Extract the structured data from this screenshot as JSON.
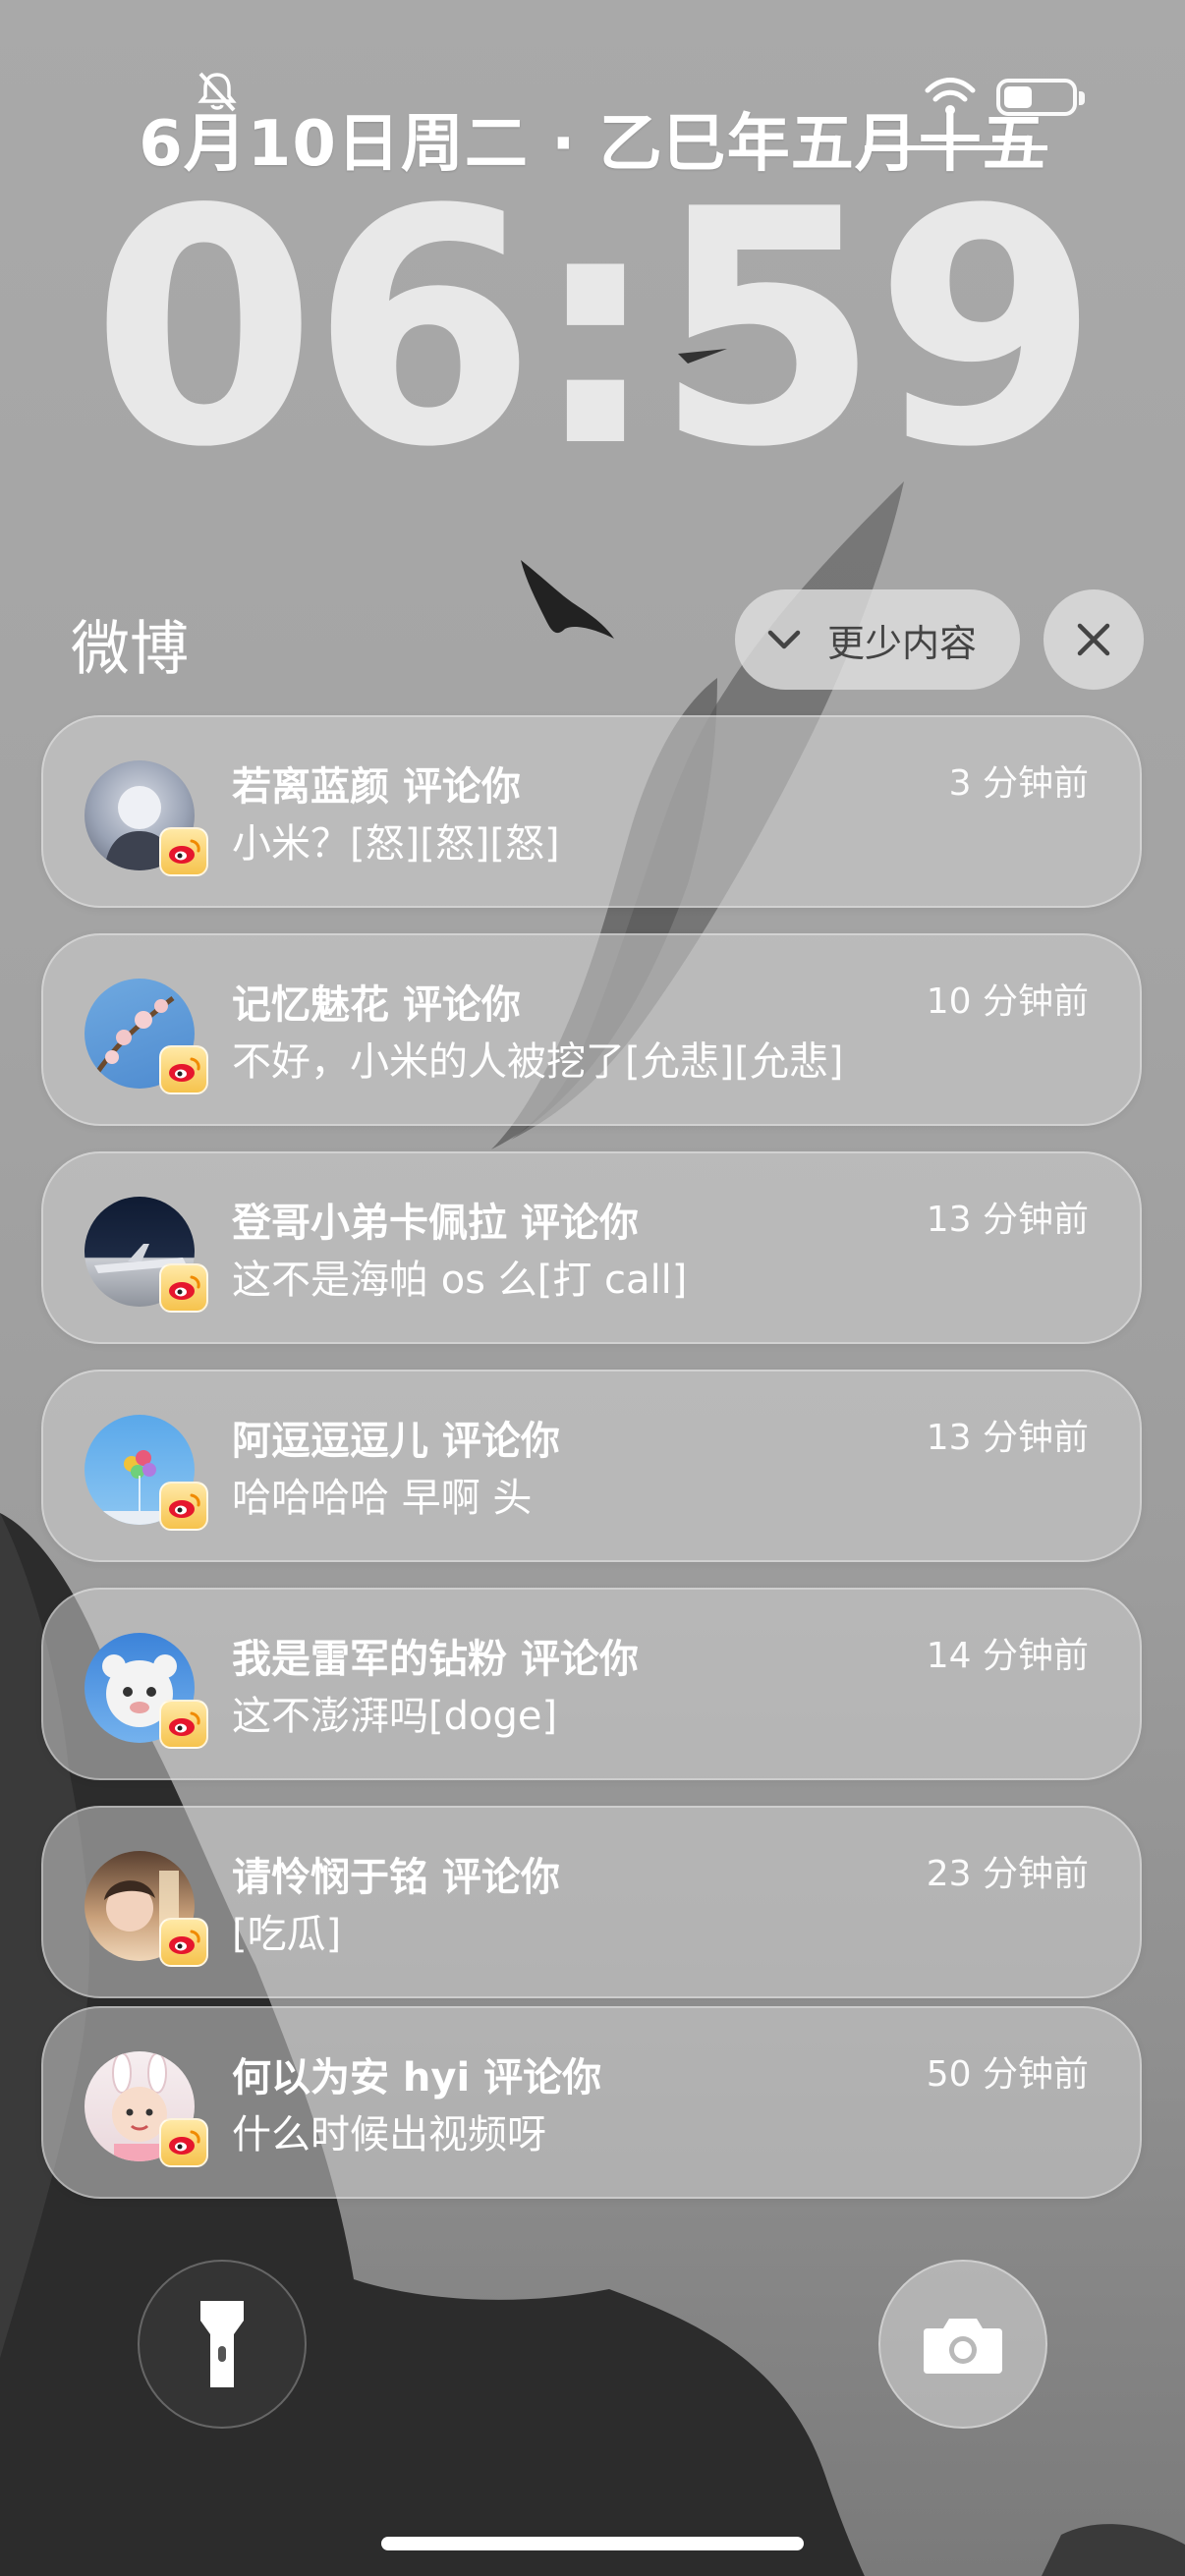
{
  "status": {
    "date": "6月10日周二 · 乙巳年五月十五",
    "time": "06:59"
  },
  "group": {
    "app_name": "微博",
    "show_less_label": "更少内容"
  },
  "notifications": [
    {
      "title": "若离蓝颜 评论你",
      "body": "小米？[怒][怒][怒]",
      "time": "3 分钟前"
    },
    {
      "title": "记忆魅花 评论你",
      "body": "不好，小米的人被挖了[允悲][允悲]",
      "time": "10 分钟前"
    },
    {
      "title": "登哥小弟卡佩拉 评论你",
      "body": "这不是海帕 os 么[打 call]",
      "time": "13 分钟前"
    },
    {
      "title": "阿逗逗逗儿 评论你",
      "body": "哈哈哈哈 早啊 头",
      "time": "13 分钟前"
    },
    {
      "title": "我是雷军的钻粉 评论你",
      "body": "这不澎湃吗[doge]",
      "time": "14 分钟前"
    },
    {
      "title": "请怜悯于铭 评论你",
      "body": "[吃瓜]",
      "time": "23 分钟前"
    },
    {
      "title": "何以为安 hyi 评论你",
      "body": "什么时候出视频呀",
      "time": "50 分钟前"
    }
  ],
  "icons": {
    "silent": "bell-slash-icon",
    "wifi": "wifi-icon",
    "battery": "battery-icon",
    "flashlight": "flashlight-icon",
    "camera": "camera-icon",
    "app_badge": "weibo-icon"
  }
}
